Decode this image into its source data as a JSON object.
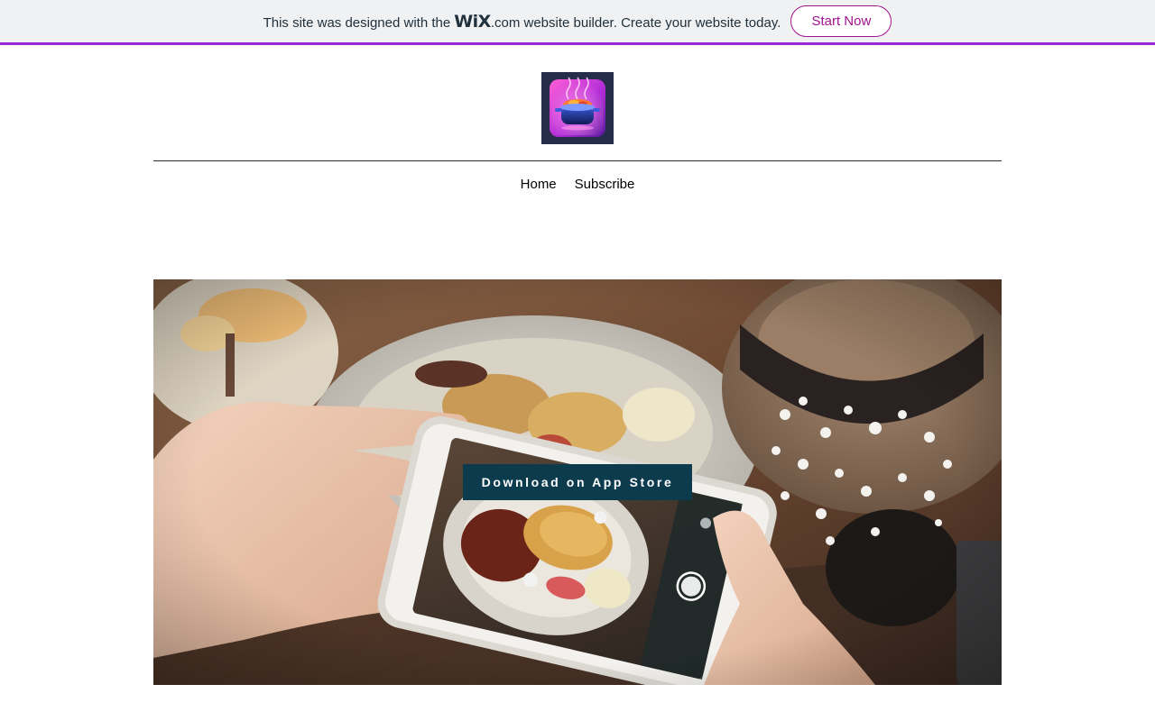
{
  "banner": {
    "text_before": "This site was designed with the",
    "wix_logo_text": "WiX",
    "text_after": ".com website builder. Create your website today.",
    "cta_label": "Start Now",
    "accent_color": "#9a27d5",
    "cta_color": "#a0138e"
  },
  "header": {
    "logo_icon": "cooking-pot-app-icon"
  },
  "nav": {
    "items": [
      {
        "label": "Home"
      },
      {
        "label": "Subscribe"
      }
    ]
  },
  "hero": {
    "image_subject": "hands-photographing-food-with-phone",
    "cta_label": "Download on App Store",
    "cta_color": "#0c3b4e"
  }
}
